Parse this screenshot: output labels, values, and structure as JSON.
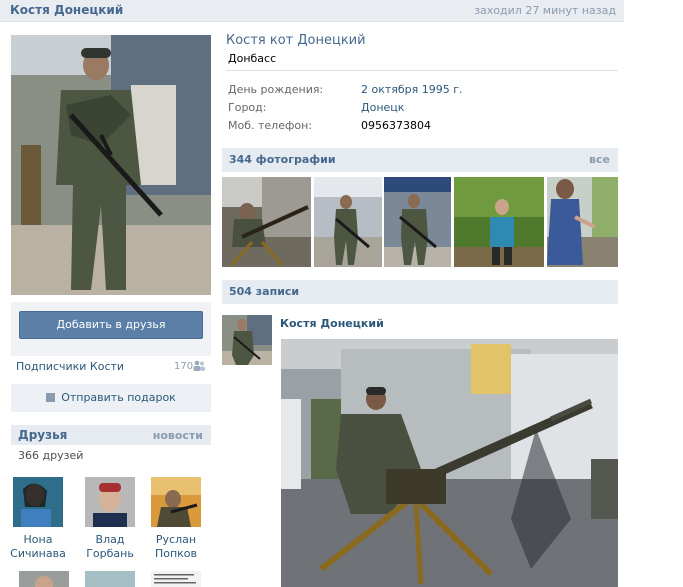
{
  "topbar": {
    "name": "Костя Донецкий",
    "last_seen": "заходил 27 минут назад"
  },
  "sidebar": {
    "add_friend_label": "Добавить в друзья",
    "subscribers_label": "Подписчики Кости",
    "subscribers_count": "170",
    "gift_label": "Отправить подарок",
    "friends_title": "Друзья",
    "friends_news": "новости",
    "friends_count": "366 друзей",
    "friends": [
      {
        "first": "Нона",
        "last": "Сичинава"
      },
      {
        "first": "Влад",
        "last": "Горбань"
      },
      {
        "first": "Руслан",
        "last": "Попков"
      }
    ]
  },
  "profile": {
    "full_name": "Костя кот Донецкий",
    "region": "Донбасс",
    "fields": [
      {
        "label": "День рождения:",
        "value": "2 октября 1995 г."
      },
      {
        "label": "Город:",
        "value": "Донецк"
      },
      {
        "label": "Моб. телефон:",
        "value": "0956373804"
      }
    ]
  },
  "photos": {
    "title": "344 фотографии",
    "all_link": "все"
  },
  "wall": {
    "title": "504 записи",
    "post_author": "Костя Донецкий"
  },
  "colors": {
    "link": "#2b587a",
    "header": "#45688e",
    "button": "#5b7fa6",
    "panel": "#e6ebf1"
  }
}
